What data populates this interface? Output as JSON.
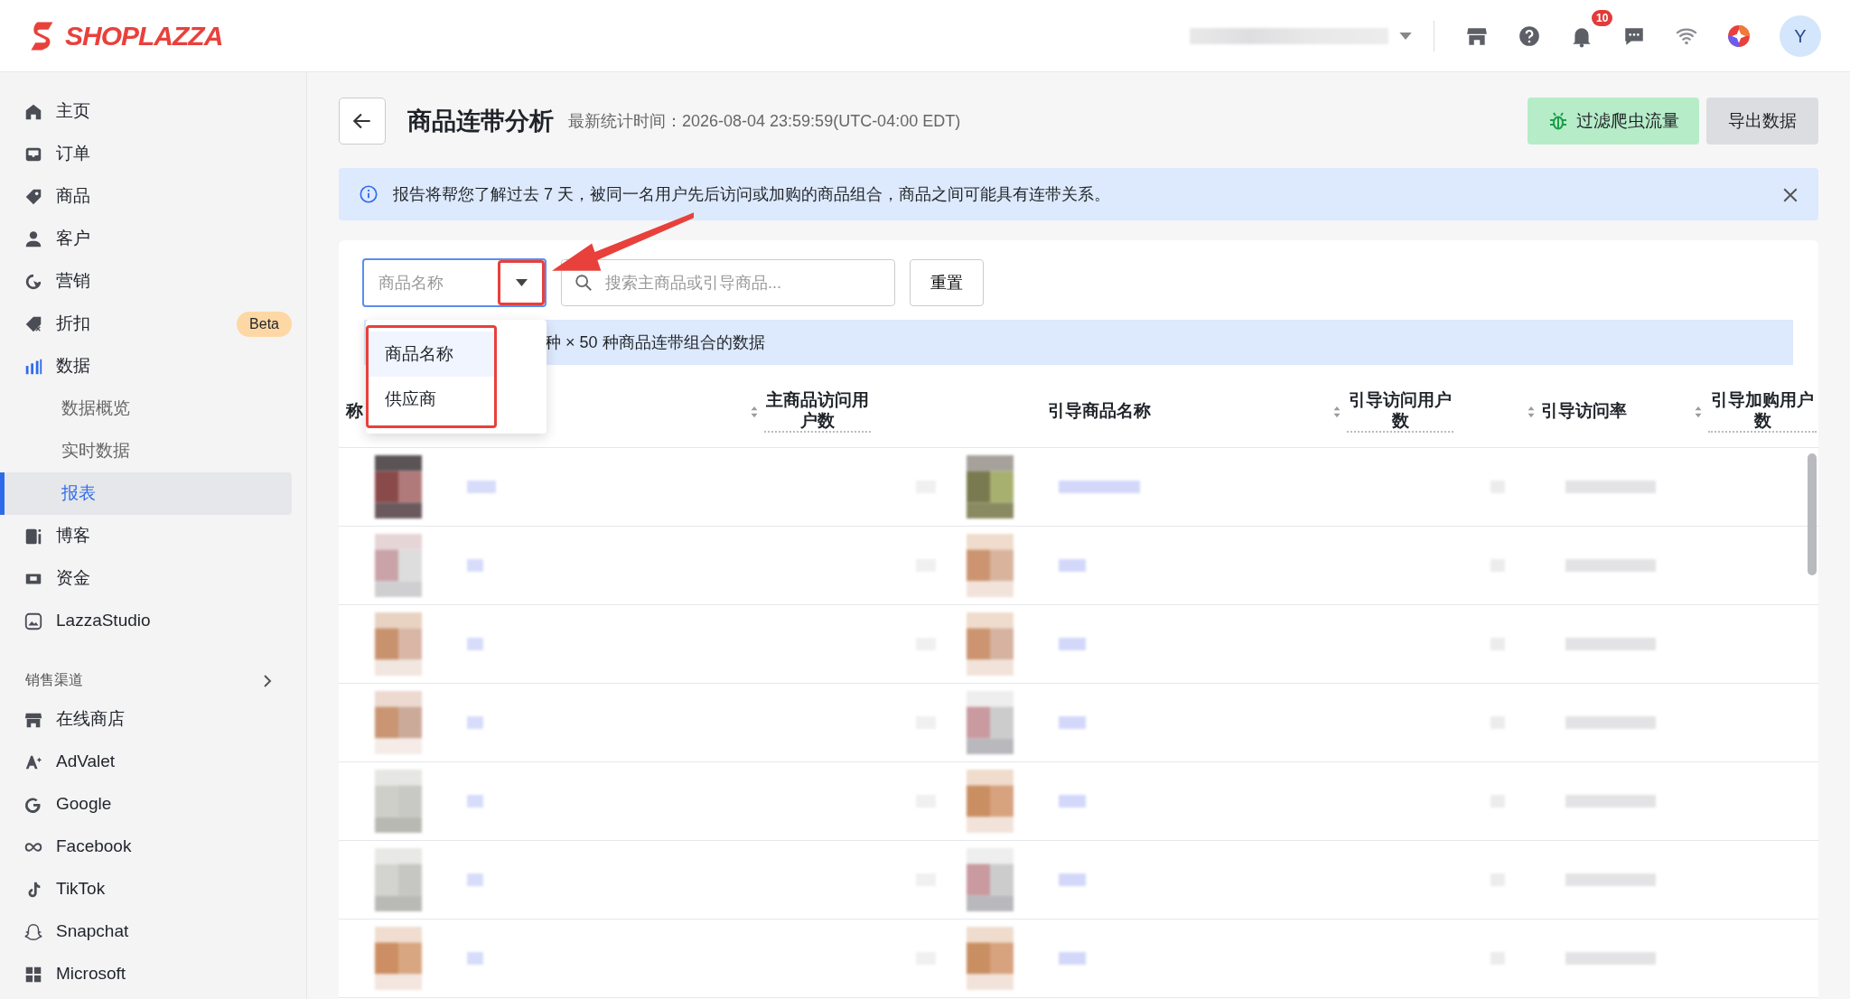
{
  "header": {
    "logo": "SHOPLAZZA",
    "store_selector": {
      "kind": "blurred"
    },
    "notification_count": "10",
    "avatar": "Y"
  },
  "sidebar": {
    "items": [
      {
        "label": "主页",
        "selected": false
      },
      {
        "label": "订单",
        "selected": false
      },
      {
        "label": "商品",
        "selected": false
      },
      {
        "label": "客户",
        "selected": false
      },
      {
        "label": "营销",
        "selected": false
      },
      {
        "label": "折扣",
        "selected": false,
        "badge": "Beta"
      },
      {
        "label": "数据",
        "selected": false,
        "children": [
          {
            "label": "数据概览",
            "selected": false
          },
          {
            "label": "实时数据",
            "selected": false
          },
          {
            "label": "报表",
            "selected": true
          }
        ]
      },
      {
        "label": "博客",
        "selected": false
      },
      {
        "label": "资金",
        "selected": false
      },
      {
        "label": "LazzaStudio",
        "selected": false
      }
    ],
    "section": {
      "title": "销售渠道",
      "expanded": false
    },
    "channels": [
      {
        "label": "在线商店"
      },
      {
        "label": "AdValet"
      },
      {
        "label": "Google"
      },
      {
        "label": "Facebook"
      },
      {
        "label": "TikTok"
      },
      {
        "label": "Snapchat"
      },
      {
        "label": "Microsoft"
      }
    ]
  },
  "page": {
    "title": "商品连带分析",
    "updated": "最新统计时间：2026-08-04 23:59:59(UTC-04:00 EDT)",
    "buttons": [
      {
        "label": "过滤爬虫流量",
        "kind": "success"
      },
      {
        "label": "导出数据",
        "kind": "secondary"
      }
    ]
  },
  "banner": {
    "text": "报告将帮您了解过去 7 天，被同一名用户先后访问或加购的商品组合，商品之间可能具有连带关系。"
  },
  "filter": {
    "select_value": "商品名称",
    "menu_open": true,
    "options": [
      {
        "label": "商品名称",
        "selected": true
      },
      {
        "label": "供应商",
        "selected": false
      }
    ],
    "search": {
      "placeholder": "搜索主商品或引导商品..."
    },
    "reset": "重置"
  },
  "summary": "种 × 50 种商品连带组合的数据",
  "annotations": {
    "highlight_toggle": true,
    "highlight_menu": true,
    "arrow": true
  },
  "table": {
    "columns": [
      {
        "label": "称",
        "kind": "plain",
        "tooltip": false
      },
      {
        "label": "主商品访问用户数",
        "kind": "sortable",
        "tooltip": true
      },
      {
        "label": "引导商品名称",
        "kind": "plain",
        "tooltip": false
      },
      {
        "label": "引导访问用户数",
        "kind": "sortable",
        "tooltip": true
      },
      {
        "label": "引导访问率",
        "kind": "sortable",
        "tooltip": false
      },
      {
        "label": "引导加购用户数",
        "kind": "sortable",
        "tooltip": true
      }
    ],
    "rows": [
      {
        "kind": "blurred"
      },
      {
        "kind": "blurred"
      },
      {
        "kind": "blurred"
      },
      {
        "kind": "blurred"
      },
      {
        "kind": "blurred"
      },
      {
        "kind": "blurred"
      },
      {
        "kind": "blurred"
      }
    ]
  }
}
